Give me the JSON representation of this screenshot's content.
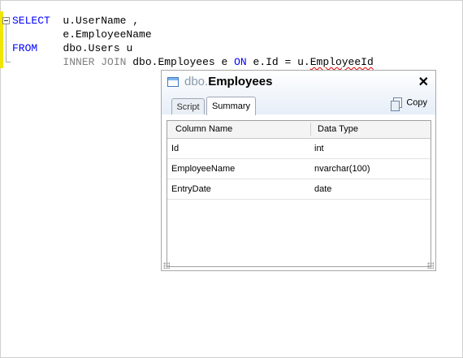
{
  "editor": {
    "lines": [
      {
        "keyword": "SELECT",
        "rest": "u.UserName ,"
      },
      {
        "keyword": "",
        "rest": "e.EmployeeName"
      },
      {
        "keyword": "FROM",
        "rest": "dbo.Users u"
      },
      {
        "join_keyword": "INNER JOIN",
        "join_table": "dbo.Employees e",
        "on_keyword": "ON",
        "condition": "e.Id = u.",
        "condition_squiggle": "EmployeeId"
      }
    ]
  },
  "popup": {
    "schema": "dbo.",
    "table": "Employees",
    "close_glyph": "✕",
    "tabs": [
      {
        "label": "Script",
        "active": false
      },
      {
        "label": "Summary",
        "active": true
      }
    ],
    "copy_label": "Copy",
    "columns": {
      "name": "Column Name",
      "type": "Data Type"
    },
    "rows": [
      {
        "name": "Id",
        "type": "int"
      },
      {
        "name": "EmployeeName",
        "type": "nvarchar(100)"
      },
      {
        "name": "EntryDate",
        "type": "date"
      }
    ]
  }
}
